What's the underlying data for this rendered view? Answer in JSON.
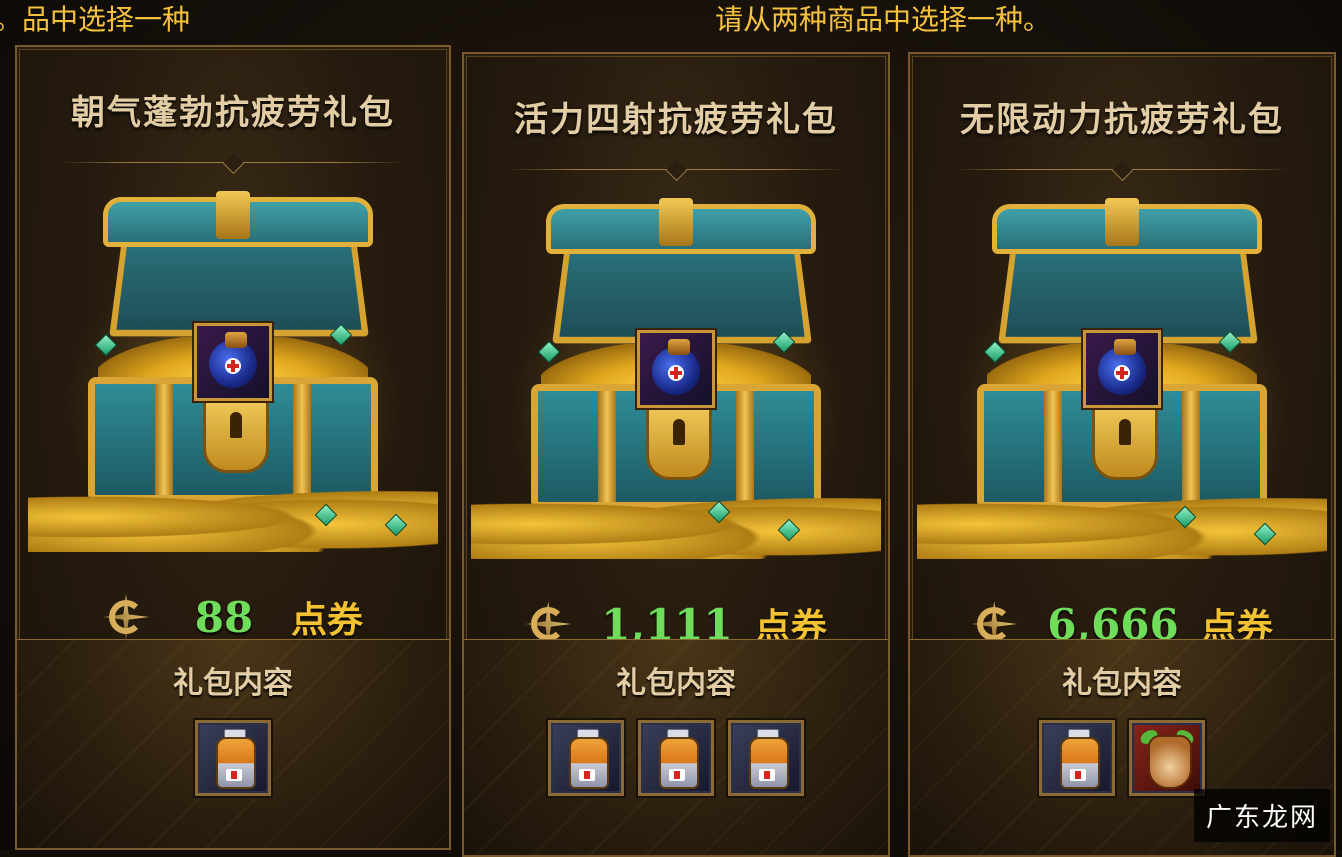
{
  "prompt_left": "品中选择一种。",
  "prompt_right": "请从两种商品中选择一种。",
  "contents_label": "礼包内容",
  "currency_icon": "coupon-currency-icon",
  "packages": [
    {
      "title": "朝气蓬勃抗疲劳礼包",
      "price": "88",
      "unit": "点券",
      "items": [
        "fatigue-potion-icon"
      ]
    },
    {
      "title": "活力四射抗疲劳礼包",
      "price": "1,111",
      "unit": "点券",
      "items": [
        "fatigue-potion-icon",
        "fatigue-potion-icon",
        "fatigue-potion-icon"
      ]
    },
    {
      "title": "无限动力抗疲劳礼包",
      "price": "6,666",
      "unit": "点券",
      "items": [
        "fatigue-potion-icon",
        "jar-icon"
      ]
    }
  ],
  "watermark": "广东龙网",
  "colors": {
    "price": "#6fdc5a",
    "unit": "#f2c232",
    "prompt": "#f6c23d",
    "frame": "#7a5a2c"
  }
}
